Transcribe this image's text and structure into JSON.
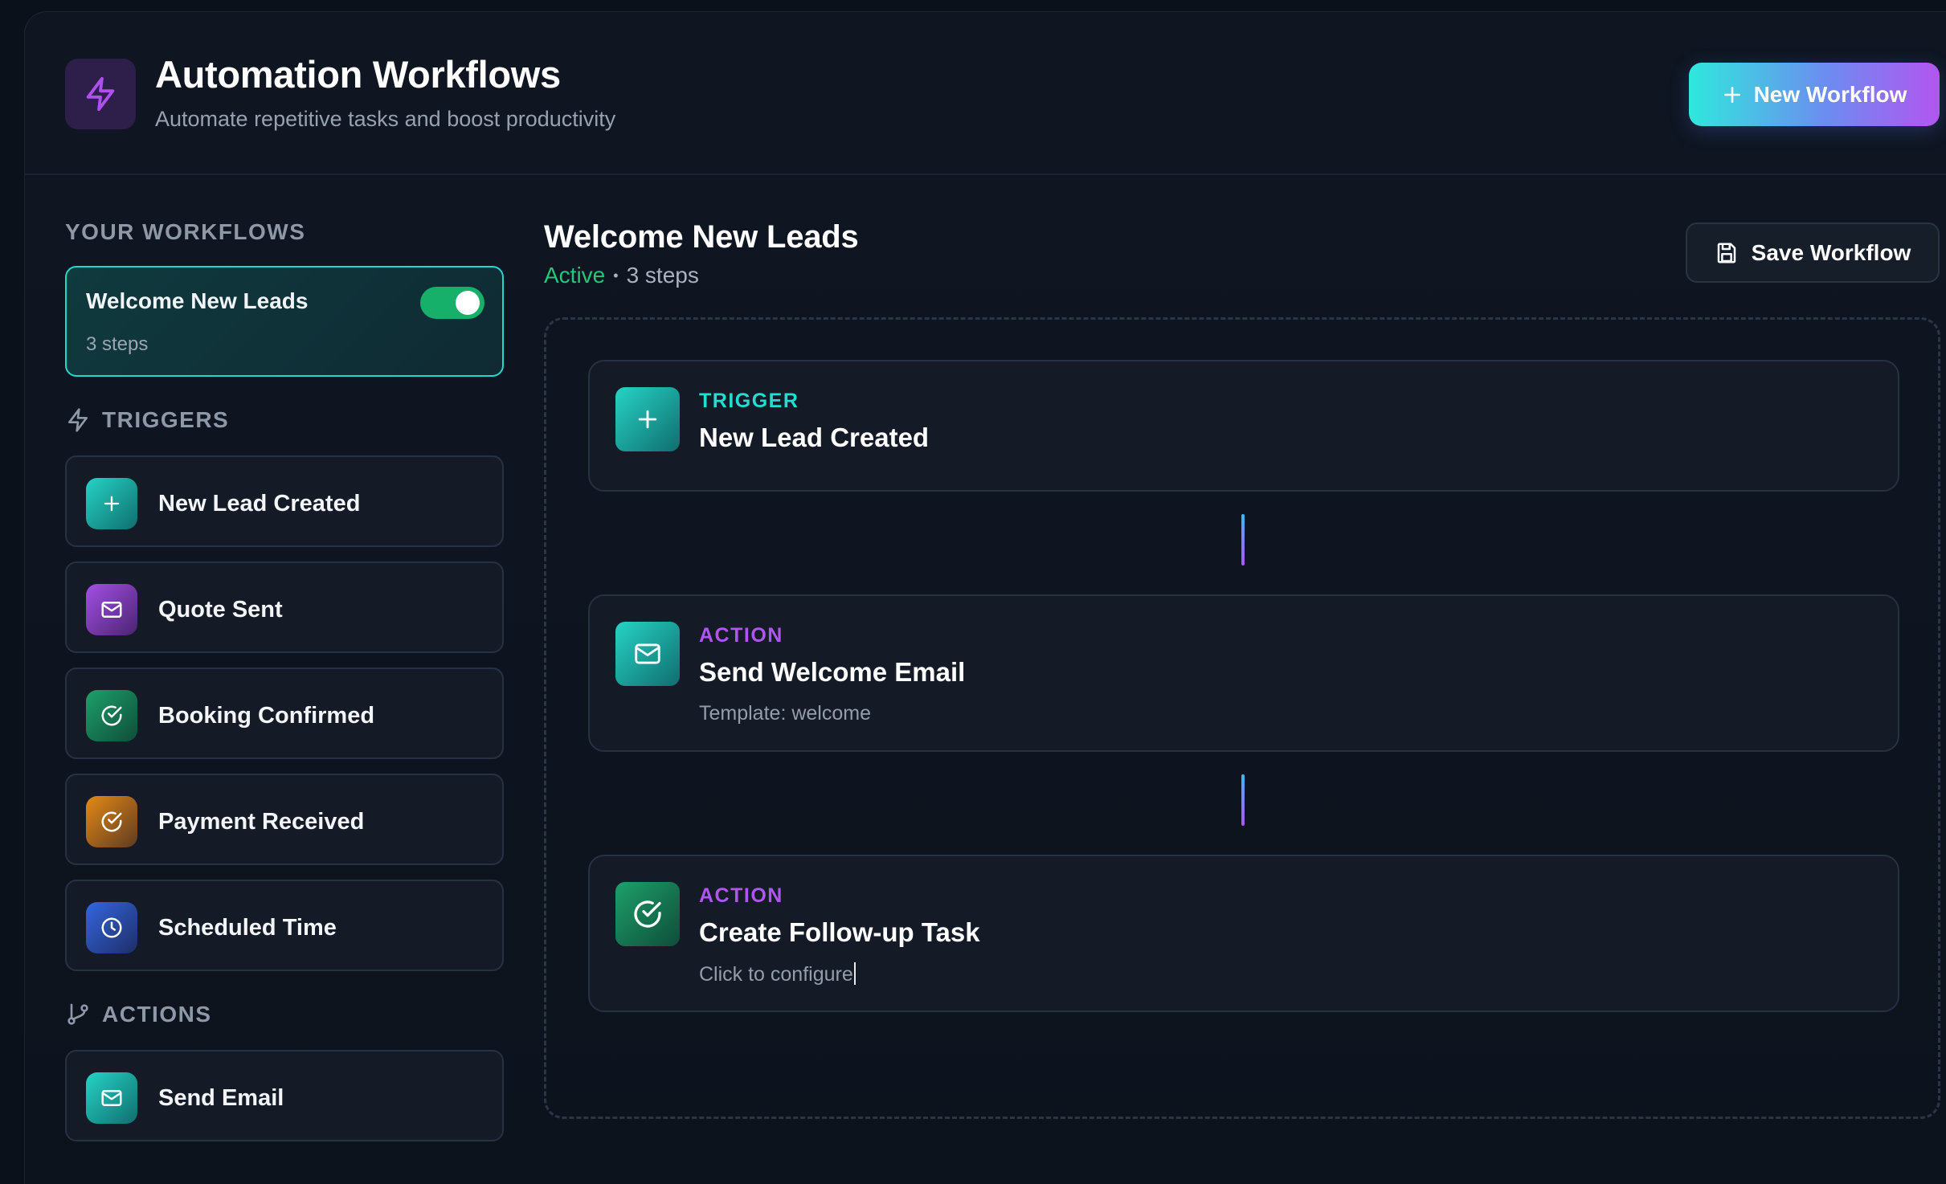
{
  "header": {
    "title": "Automation Workflows",
    "subtitle": "Automate repetitive tasks and boost productivity",
    "new_workflow_label": "New Workflow"
  },
  "sidebar": {
    "your_workflows_label": "YOUR WORKFLOWS",
    "workflow": {
      "name": "Welcome New Leads",
      "steps": "3 steps",
      "enabled": true
    },
    "triggers_label": "TRIGGERS",
    "triggers": [
      {
        "label": "New Lead Created",
        "icon": "plus-icon",
        "color": "#1fd0c4"
      },
      {
        "label": "Quote Sent",
        "icon": "mail-icon",
        "color": "#a44fe6"
      },
      {
        "label": "Booking Confirmed",
        "icon": "check-circle-icon",
        "color": "#1ea06a"
      },
      {
        "label": "Payment Received",
        "icon": "check-circle-icon",
        "color": "#e48a16"
      },
      {
        "label": "Scheduled Time",
        "icon": "clock-icon",
        "color": "#3366e0"
      }
    ],
    "actions_label": "ACTIONS",
    "actions": [
      {
        "label": "Send Email",
        "icon": "mail-icon",
        "color": "#1fd0c4"
      }
    ]
  },
  "main": {
    "title": "Welcome New Leads",
    "status": "Active",
    "separator": "•",
    "steps_count": "3 steps",
    "save_label": "Save Workflow",
    "steps": [
      {
        "kind": "TRIGGER",
        "title": "New Lead Created",
        "subtitle": "",
        "icon": "plus-icon",
        "kind_color": "#25dcd2"
      },
      {
        "kind": "ACTION",
        "title": "Send Welcome Email",
        "subtitle": "Template: welcome",
        "icon": "mail-icon",
        "kind_color": "#b155f2"
      },
      {
        "kind": "ACTION",
        "title": "Create Follow-up Task",
        "subtitle": "Click to configure",
        "icon": "check-circle-icon",
        "kind_color": "#b155f2"
      }
    ]
  }
}
